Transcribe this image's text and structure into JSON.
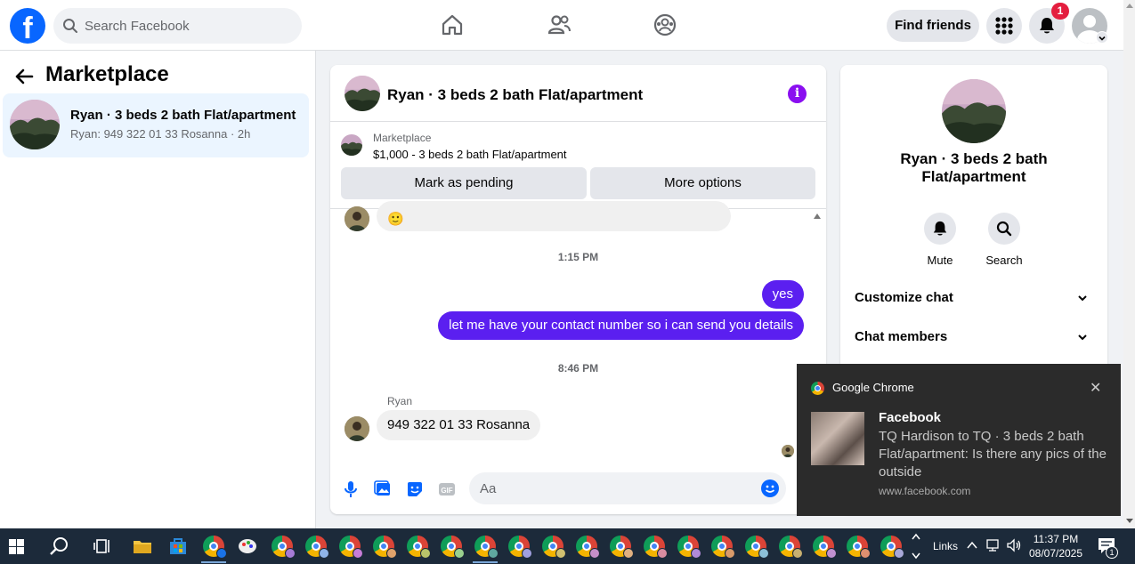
{
  "topbar": {
    "search_placeholder": "Search Facebook",
    "find_friends_label": "Find friends",
    "notification_count": "1"
  },
  "sidebar": {
    "title": "Marketplace",
    "conversations": [
      {
        "name": "Ryan · 3 beds 2 bath Flat/apartment",
        "preview": "Ryan: 949 322 01 33 Rosanna · 2h"
      }
    ]
  },
  "chat": {
    "title": "Ryan · 3 beds 2 bath Flat/apartment",
    "listing_source": "Marketplace",
    "listing_line": "$1,000 - 3 beds 2 bath Flat/apartment",
    "mark_pending_label": "Mark as pending",
    "more_options_label": "More options",
    "messages": {
      "emoji_reply": "🙂",
      "time_1": "1:15 PM",
      "out_1": "yes",
      "out_2": "let me have your contact number so i can send you details",
      "time_2": "8:46 PM",
      "sender": "Ryan",
      "in_1": "949 322 01 33 Rosanna"
    },
    "composer_placeholder": "Aa"
  },
  "right_panel": {
    "title": "Ryan · 3 beds 2 bath Flat/apartment",
    "mute_label": "Mute",
    "search_label": "Search",
    "sections": [
      "Customize chat",
      "Chat members"
    ]
  },
  "notification": {
    "app": "Google Chrome",
    "title": "Facebook",
    "body": "TQ Hardison to TQ · 3 beds 2 bath Flat/apartment: Is there any pics of the outside",
    "url": "www.facebook.com"
  },
  "taskbar": {
    "links_label": "Links",
    "time": "11:37 PM",
    "date": "08/07/2025",
    "action_center_count": "1"
  },
  "colors": {
    "brand": "#0866ff",
    "outgoing_bubble": "#5b1ff0",
    "info_icon": "#8a0ff0",
    "badge": "#e41e3f"
  }
}
